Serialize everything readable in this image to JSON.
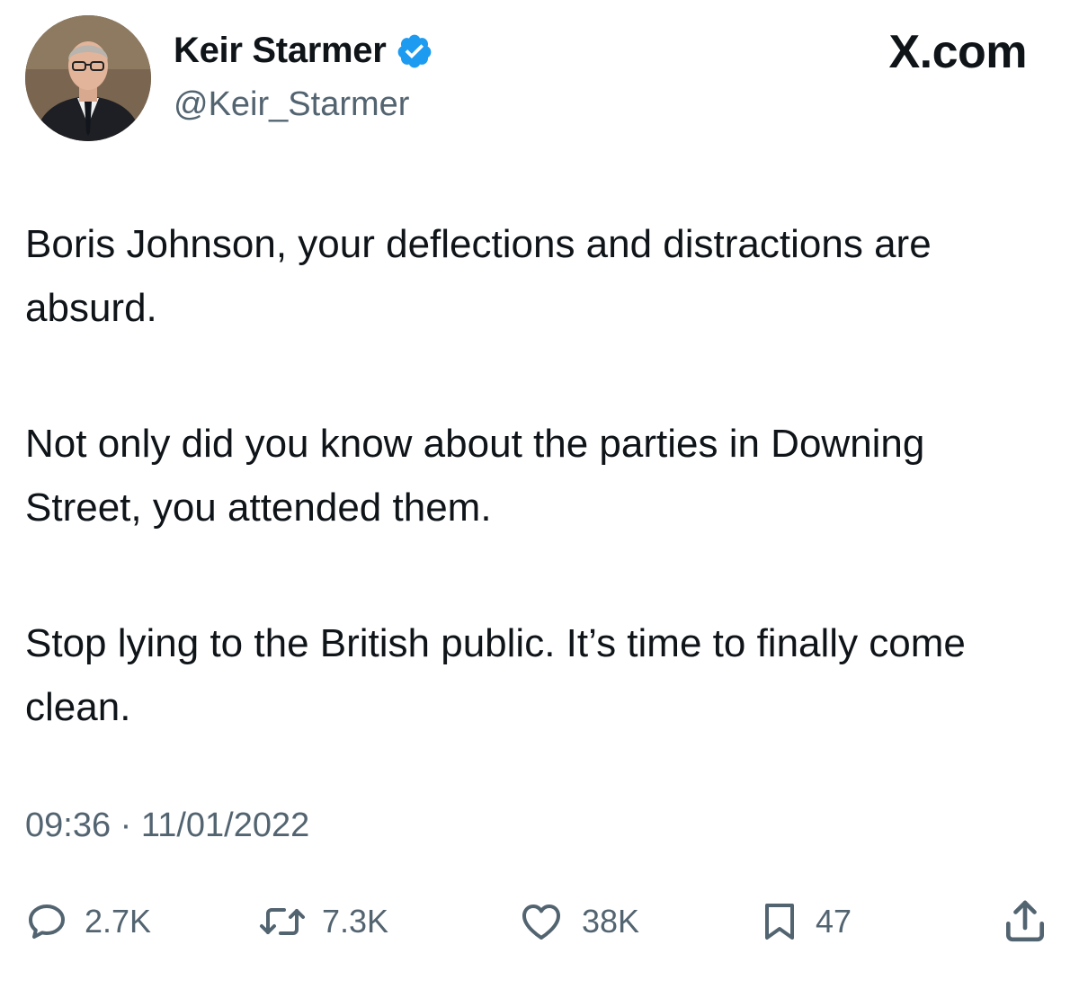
{
  "author": {
    "display_name": "Keir Starmer",
    "handle": "@Keir_Starmer",
    "verified": true,
    "avatar_icon": "profile-photo",
    "verified_icon": "verified-badge-icon",
    "verified_color": "#1d9bf0"
  },
  "brand": "X.com",
  "tweet": {
    "paragraphs": [
      "Boris Johnson, your deflections and distractions are absurd.",
      "Not only did you know about the parties in Downing Street, you attended them.",
      "Stop lying to the British public. It’s time to finally come clean."
    ]
  },
  "meta": {
    "time": "09:36",
    "separator": "·",
    "date": "11/01/2022"
  },
  "actions": {
    "reply": {
      "icon": "reply-icon",
      "count": "2.7K"
    },
    "repost": {
      "icon": "repost-icon",
      "count": "7.3K"
    },
    "like": {
      "icon": "heart-icon",
      "count": "38K"
    },
    "bookmark": {
      "icon": "bookmark-icon",
      "count": "47"
    },
    "share": {
      "icon": "share-icon"
    }
  },
  "colors": {
    "text": "#0f1419",
    "secondary": "#536471",
    "background": "#ffffff"
  }
}
